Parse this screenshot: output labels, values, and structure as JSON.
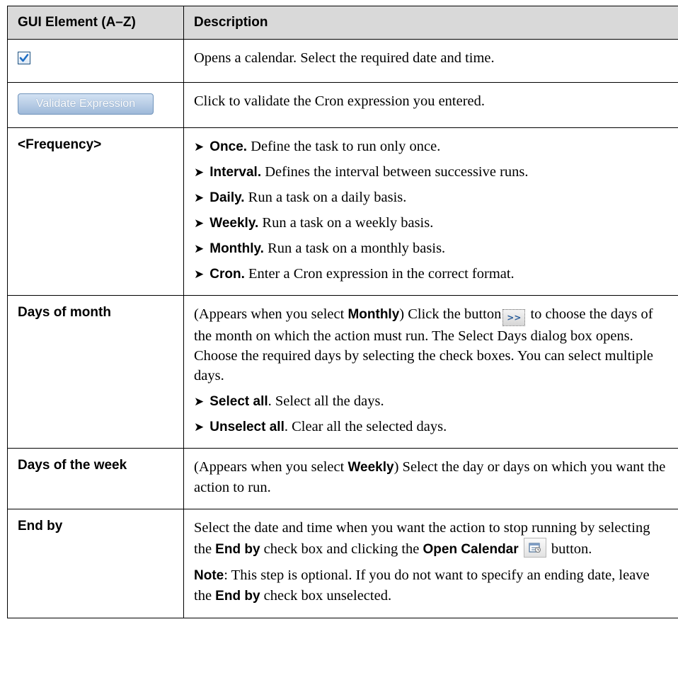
{
  "table": {
    "headers": [
      "GUI Element (A–Z)",
      "Description"
    ],
    "rows": {
      "checkbox": {
        "element_icon": "checkbox-checked-icon",
        "description": "Opens a calendar. Select the required date and time."
      },
      "validate": {
        "element_label": "Validate Expression",
        "description": "Click to validate the Cron expression you entered."
      },
      "frequency": {
        "element": "<Frequency>",
        "bullets": [
          {
            "kw": "Once.",
            "text": " Define the task to run only once."
          },
          {
            "kw": "Interval.",
            "text": " Defines the interval between successive runs."
          },
          {
            "kw": "Daily.",
            "text": " Run a task on a daily basis."
          },
          {
            "kw": "Weekly.",
            "text": " Run a task on a weekly basis."
          },
          {
            "kw": "Monthly.",
            "text": " Run a task on a monthly basis."
          },
          {
            "kw": "Cron.",
            "text": " Enter a Cron expression in the correct format."
          }
        ]
      },
      "days_of_month": {
        "element": "Days of month",
        "p1_a": "(Appears when you select ",
        "p1_kw": "Monthly",
        "p1_b": ") Click the button",
        "button_label": ">>",
        "p1_c": " to choose the days of the month on which the action must run. The Select Days dialog box opens. Choose the required days by selecting the check boxes. You can select multiple days.",
        "bullets": [
          {
            "kw": "Select all",
            "text": ". Select all the days."
          },
          {
            "kw": "Unselect all",
            "text": ". Clear all the selected days."
          }
        ]
      },
      "days_of_week": {
        "element": "Days of the week",
        "p_a": "(Appears when you select ",
        "p_kw": "Weekly",
        "p_b": ") Select the day or days on which you want the action to run."
      },
      "end_by": {
        "element": "End by",
        "p1_a": "Select the date and time when you want the action to stop running by selecting the ",
        "p1_kw1": "End by",
        "p1_b": " check box and clicking the ",
        "p1_kw2": "Open Calendar",
        "p1_icon": "open-calendar-icon",
        "p1_c": " button.",
        "p2_kw": "Note",
        "p2_a": ": This step is optional. If you do not want to specify an ending date, leave the ",
        "p2_kw2": "End by",
        "p2_b": " check box unselected."
      }
    }
  },
  "colors": {
    "header_bg": "#d9d9d9",
    "border": "#000000",
    "button_face": "#a9c2e0",
    "checkmark": "#1f6fc4"
  }
}
